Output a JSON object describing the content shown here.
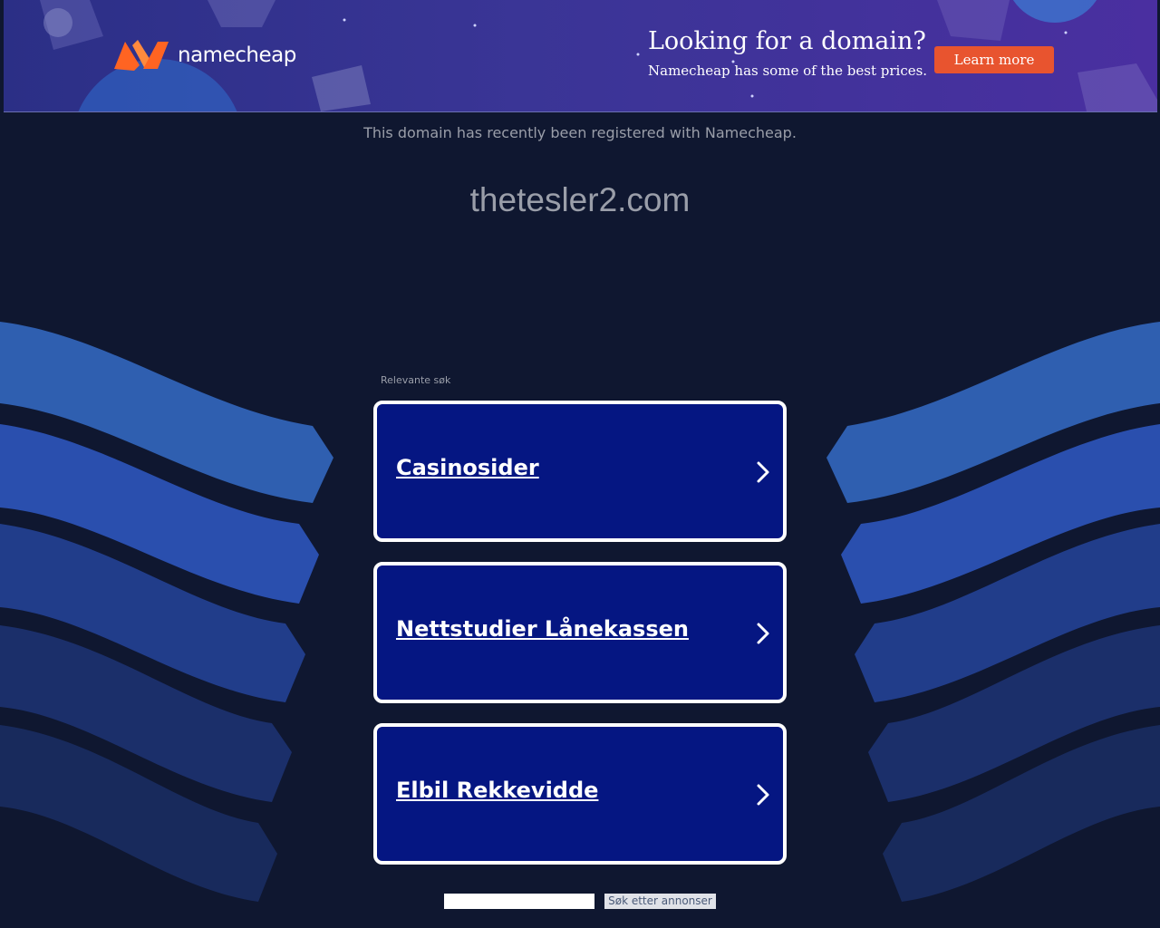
{
  "banner": {
    "logo_text": "namecheap",
    "promo_title": "Looking for a domain?",
    "promo_subtitle": "Namecheap has some of the best prices.",
    "learn_more_label": "Learn more",
    "brand_color": "#ff6422",
    "button_color": "#e8542f"
  },
  "main": {
    "notice": "This domain has recently been registered with Namecheap.",
    "domain": "thetesler2.com",
    "related_label": "Relevante søk",
    "links": [
      {
        "label": "Casinosider"
      },
      {
        "label": "Nettstudier Lånekassen"
      },
      {
        "label": "Elbil Rekkevidde"
      }
    ]
  },
  "search": {
    "input_value": "",
    "button_label": "Søk etter annonser"
  },
  "colors": {
    "page_background": "#0f1730",
    "card_background": "#051682",
    "card_border": "#ffffff",
    "muted_text": "#9a9ea9"
  }
}
